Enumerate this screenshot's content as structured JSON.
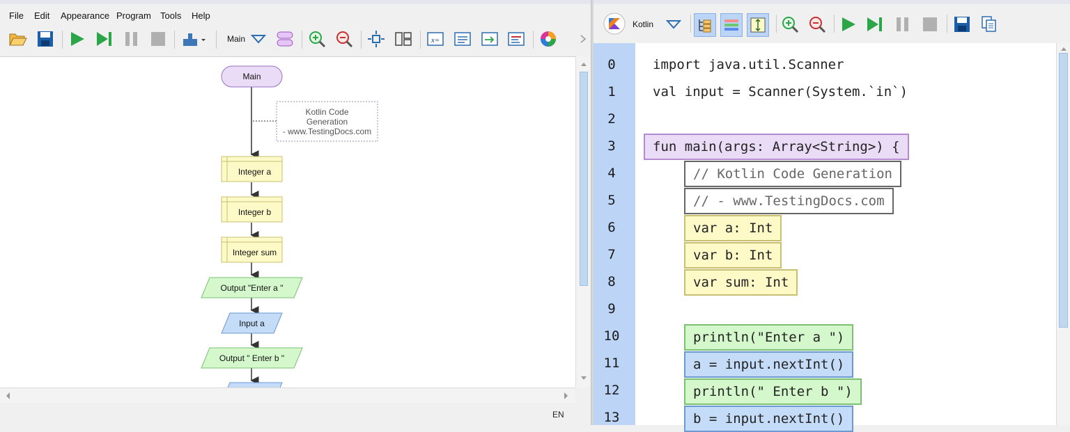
{
  "menu": [
    "File",
    "Edit",
    "Appearance",
    "Program",
    "Tools",
    "Help"
  ],
  "toolbar": {
    "main_label": "Main"
  },
  "flowchart": {
    "start": "Main",
    "comment": [
      "Kotlin Code",
      "Generation",
      "- www.TestingDocs.com"
    ],
    "declare_a": "Integer a",
    "declare_b": "Integer b",
    "declare_sum": "Integer sum",
    "output_a": "Output \"Enter a \"",
    "input_a": "Input a",
    "output_b": "Output \" Enter b \""
  },
  "status": {
    "lang": "EN"
  },
  "editor": {
    "language": "Kotlin",
    "lines": [
      {
        "n": "0",
        "text": "import java.util.Scanner"
      },
      {
        "n": "1",
        "text": "val input = Scanner(System.`in`)"
      },
      {
        "n": "2",
        "text": ""
      },
      {
        "n": "3",
        "text": "fun main(args: Array<String>) {"
      },
      {
        "n": "4",
        "text": "// Kotlin Code Generation"
      },
      {
        "n": "5",
        "text": "// - www.TestingDocs.com"
      },
      {
        "n": "6",
        "text": "var a: Int"
      },
      {
        "n": "7",
        "text": "var b: Int"
      },
      {
        "n": "8",
        "text": "var sum: Int"
      },
      {
        "n": "9",
        "text": ""
      },
      {
        "n": "10",
        "text": "println(\"Enter a \")"
      },
      {
        "n": "11",
        "text": "a = input.nextInt()"
      },
      {
        "n": "12",
        "text": "println(\" Enter b \")"
      },
      {
        "n": "13",
        "text": "b = input.nextInt()"
      }
    ]
  },
  "colors": {
    "gutter": "#bcd4f6",
    "function": "#eadcf6",
    "declare": "#fdfac8",
    "output": "#d4f8cc",
    "input": "#c4dcf8",
    "comment": "#ffffff"
  }
}
